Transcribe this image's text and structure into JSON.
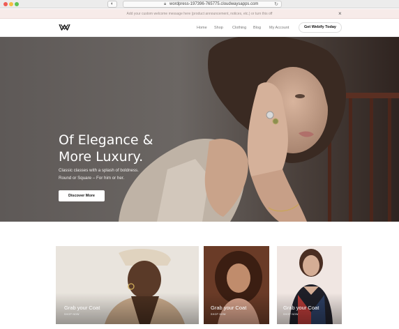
{
  "browser": {
    "url": "wordpress-197396-765775.cloudwaysapps.com",
    "lock_icon": "lock-icon",
    "reload_icon": "reload-icon"
  },
  "announcement": {
    "message": "Add your custom welcome message here (product announcement, notices, etc.) or turn this off",
    "close_label": "×"
  },
  "header": {
    "logo": "webify-logo",
    "nav": [
      "Home",
      "Shop",
      "Clothing",
      "Blog",
      "My Account"
    ],
    "cta_label": "Get Webify Today"
  },
  "hero": {
    "title_line1": "Of Elegance &",
    "title_line2": "More Luxury.",
    "subtitle_line1": "Classic classes with a splash of boldness.",
    "subtitle_line2": "Round or Square – For him or her.",
    "button_label": "Discover More"
  },
  "cards": [
    {
      "title": "Grab your Coat",
      "link": "SHOP NOW"
    },
    {
      "title": "Grab your Coat",
      "link": "SHOP NOW"
    },
    {
      "title": "Grab your Coat",
      "link": "SHOP NOW"
    }
  ],
  "colors": {
    "announcement_bg": "#f7ebe9",
    "hero_bg": "#5d5856",
    "button_bg": "#ffffff"
  }
}
